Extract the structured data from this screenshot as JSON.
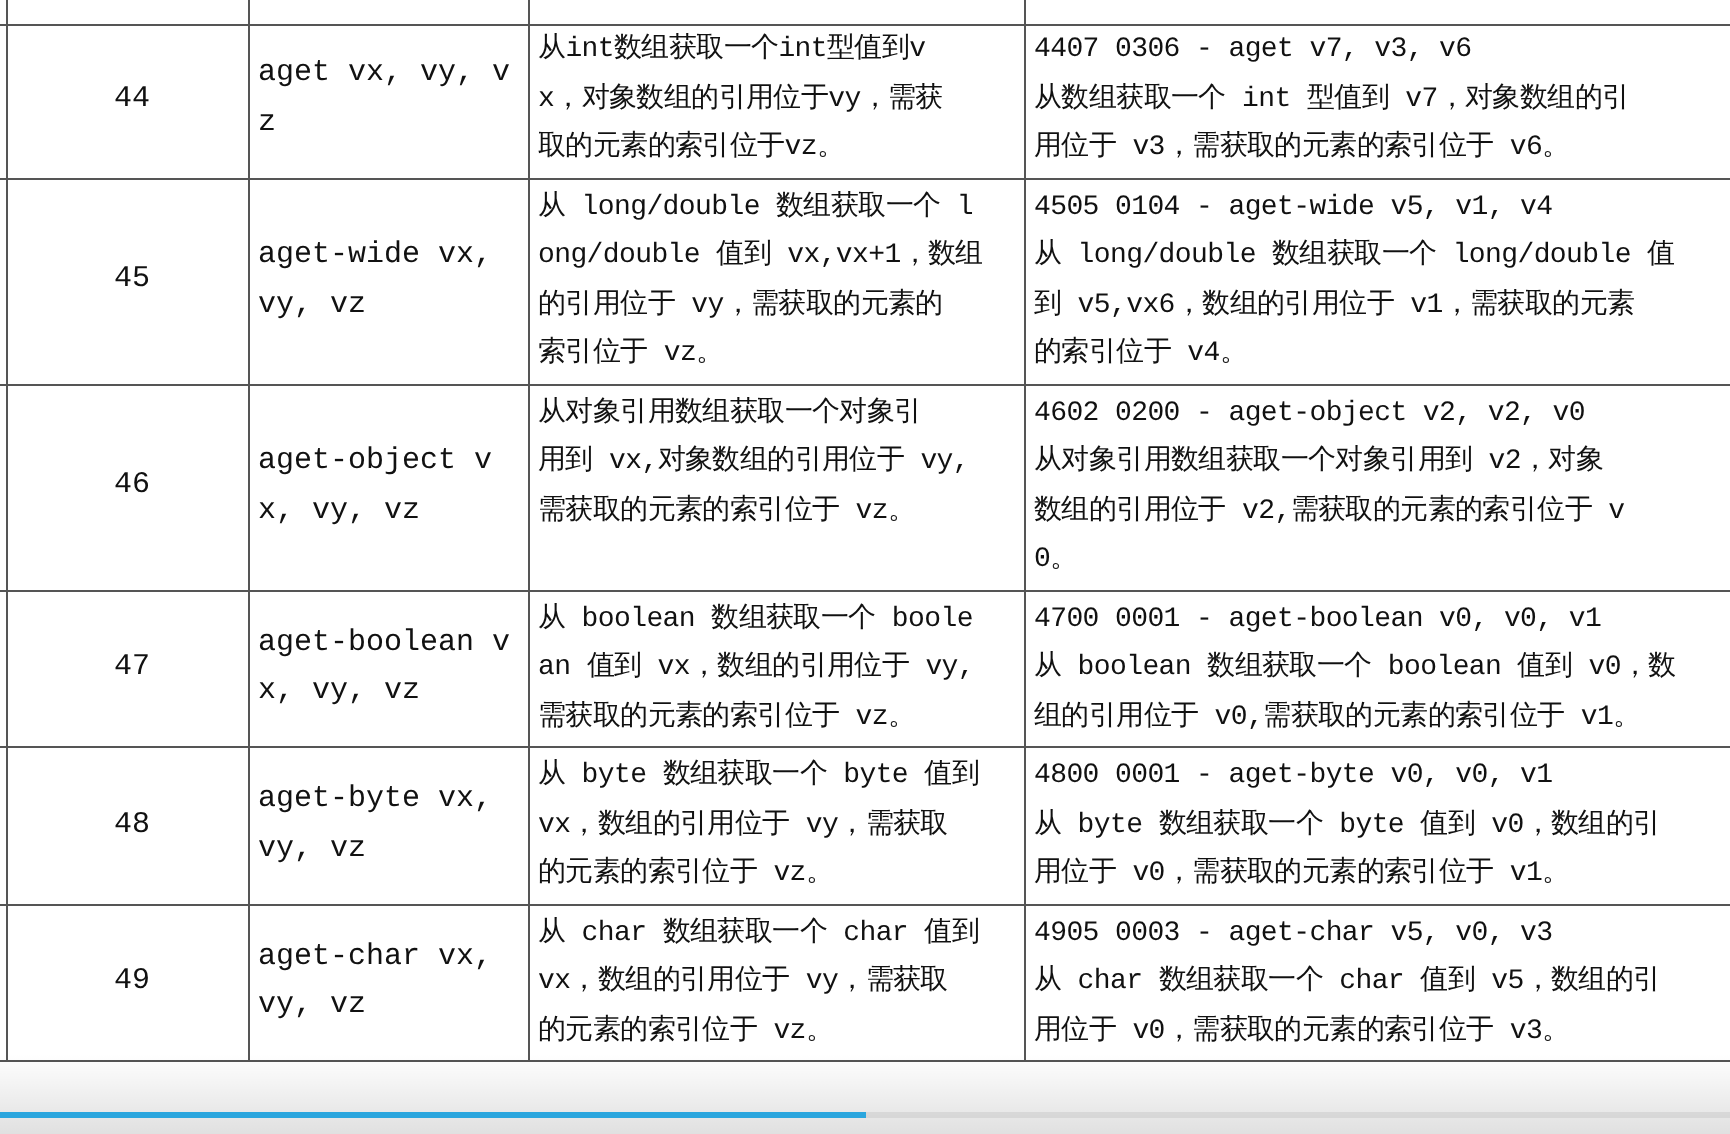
{
  "rows": [
    {
      "number": "44",
      "syntax": [
        "aget vx, vy, v",
        "z"
      ],
      "description": [
        "从int数组获取一个int型值到v",
        "x，对象数组的引用位于vy，需获",
        "取的元素的索引位于vz。"
      ],
      "example_code": "4407 0306 - aget v7, v3, v6",
      "example_description": [
        "从数组获取一个 int 型值到 v7，对象数组的引",
        "用位于 v3，需获取的元素的索引位于 v6。"
      ]
    },
    {
      "number": "45",
      "syntax": [
        "aget-wide vx,",
        "vy, vz"
      ],
      "description": [
        "从 long/double 数组获取一个 l",
        "ong/double 值到 vx,vx+1，数组",
        "的引用位于 vy，需获取的元素的",
        "索引位于 vz。"
      ],
      "example_code": "4505 0104 - aget-wide v5, v1, v4",
      "example_description": [
        "从 long/double 数组获取一个 long/double 值",
        "到 v5,vx6，数组的引用位于 v1，需获取的元素",
        "的索引位于 v4。"
      ]
    },
    {
      "number": "46",
      "syntax": [
        "aget-object v",
        "x, vy, vz"
      ],
      "description": [
        "从对象引用数组获取一个对象引",
        "用到 vx,对象数组的引用位于 vy,",
        "需获取的元素的索引位于 vz。"
      ],
      "example_code": "4602 0200 - aget-object v2, v2, v0",
      "example_description": [
        "从对象引用数组获取一个对象引用到 v2，对象",
        "数组的引用位于 v2,需获取的元素的索引位于 v",
        "0。"
      ]
    },
    {
      "number": "47",
      "syntax": [
        "aget-boolean v",
        "x, vy, vz"
      ],
      "description": [
        "从 boolean 数组获取一个 boole",
        "an 值到 vx，数组的引用位于 vy,",
        "需获取的元素的索引位于 vz。"
      ],
      "example_code": "4700 0001 - aget-boolean v0, v0, v1",
      "example_description": [
        "从 boolean 数组获取一个 boolean 值到 v0，数",
        "组的引用位于 v0,需获取的元素的索引位于 v1。"
      ]
    },
    {
      "number": "48",
      "syntax": [
        "aget-byte vx,",
        "vy, vz"
      ],
      "description": [
        "从 byte 数组获取一个 byte 值到",
        "vx，数组的引用位于 vy，需获取",
        "的元素的索引位于 vz。"
      ],
      "example_code": "4800 0001 - aget-byte v0, v0, v1",
      "example_description": [
        "从 byte 数组获取一个 byte 值到 v0，数组的引",
        "用位于 v0，需获取的元素的索引位于 v1。"
      ]
    },
    {
      "number": "49",
      "syntax": [
        "aget-char vx,",
        "vy, vz"
      ],
      "description": [
        "从 char 数组获取一个 char 值到",
        "vx，数组的引用位于 vy，需获取",
        "的元素的索引位于 vz。"
      ],
      "example_code": "4905 0003 - aget-char v5, v0, v3",
      "example_description": [
        "从 char 数组获取一个 char 值到 v5，数组的引",
        "用位于 v0，需获取的元素的索引位于 v3。"
      ]
    }
  ],
  "video_progress": {
    "level": 0.5
  }
}
